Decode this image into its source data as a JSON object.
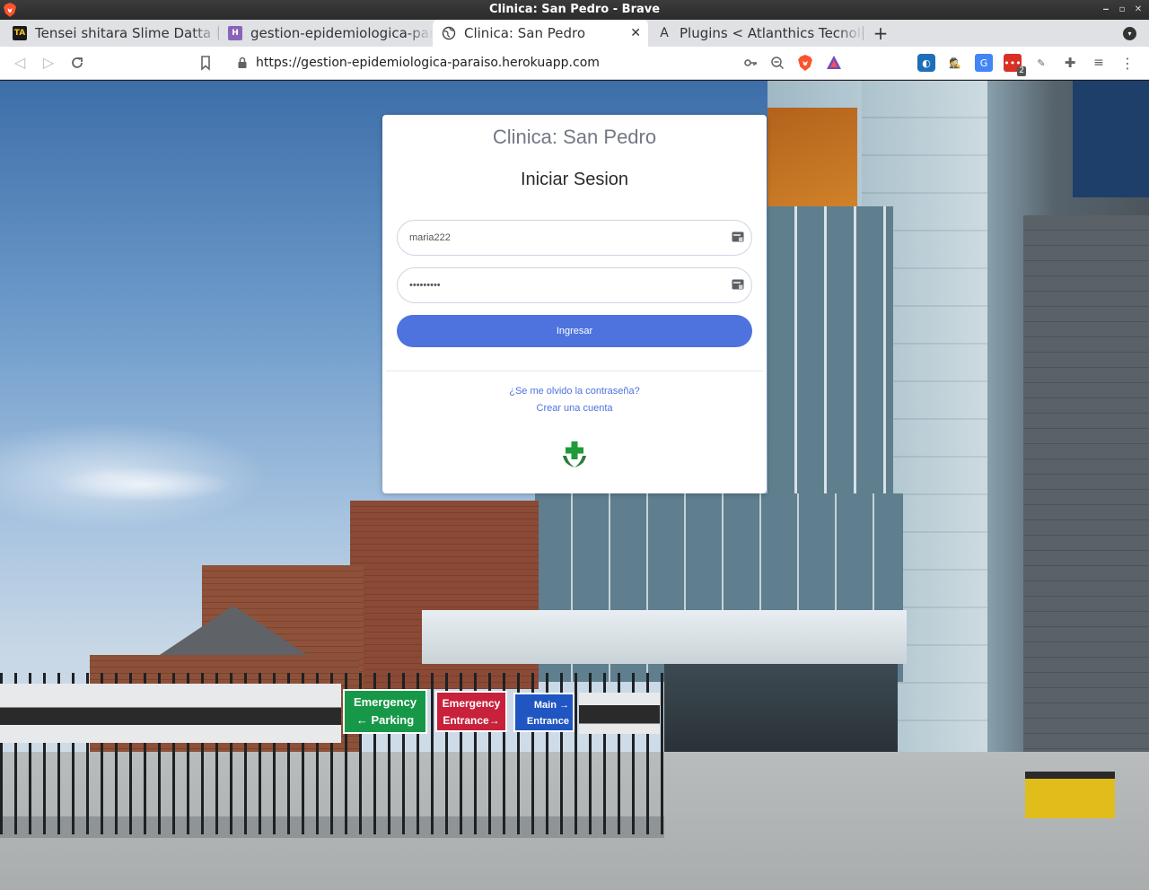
{
  "window": {
    "title": "Clinica: San Pedro - Brave"
  },
  "tabs": [
    {
      "label": "Tensei shitara Slime Datta Ken",
      "favicon_text": "TA",
      "active": false
    },
    {
      "label": "gestion-epidemiologica-paraiso",
      "favicon_text": "H",
      "active": false
    },
    {
      "label": "Clinica: San Pedro",
      "favicon_text": "",
      "active": true
    },
    {
      "label": "Plugins < Atlanthics Tecnologia",
      "favicon_text": "A",
      "active": false
    }
  ],
  "toolbar": {
    "url": "https://gestion-epidemiologica-paraiso.herokuapp.com",
    "extension_badge": "2"
  },
  "login": {
    "clinic_title": "Clinica: San Pedro",
    "heading": "Iniciar Sesion",
    "username_value": "maria222",
    "password_value": "•••••••••",
    "submit_label": "Ingresar",
    "forgot_link": "¿Se me olvido la contraseña?",
    "create_link": "Crear una cuenta"
  },
  "background_signs": {
    "sign1_line1": "Emergency",
    "sign1_line2": "← Parking",
    "sign2_line1": "Emergency",
    "sign2_line2": "Entrance→",
    "sign3_line1": "Main →",
    "sign3_line2": "Entrance"
  },
  "colors": {
    "primary_button": "#4e73df",
    "link": "#4e73df",
    "logo_green": "#1f9a3a"
  }
}
